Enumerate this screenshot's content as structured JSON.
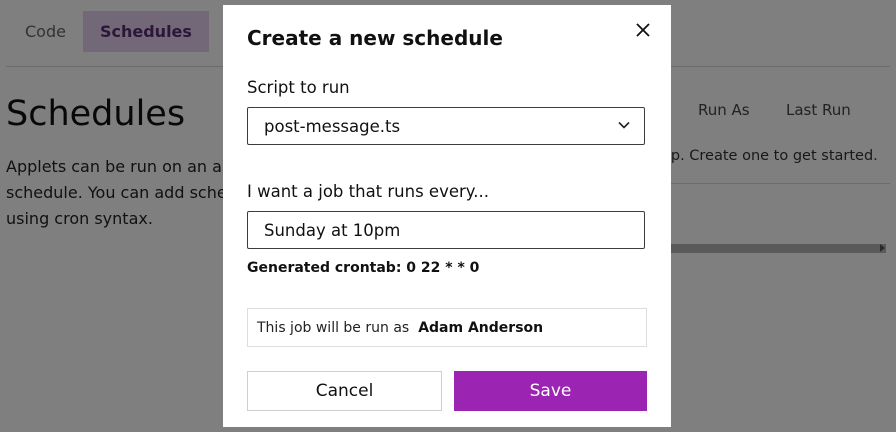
{
  "background": {
    "tabs": [
      {
        "label": "Code",
        "active": false
      },
      {
        "label": "Schedules",
        "active": true
      }
    ],
    "page_title": "Schedules",
    "description": "Applets can be run on an automatic schedule. You can add schedules using cron syntax.",
    "table": {
      "columns": [
        "Run As",
        "Last Run"
      ],
      "empty_message": "op. Create one to get started."
    }
  },
  "modal": {
    "title": "Create a new schedule",
    "close_icon": "close-icon",
    "script_label": "Script to run",
    "script_value": "post-message.ts",
    "schedule_label": "I want a job that runs every...",
    "schedule_value": "Sunday at 10pm",
    "crontab_text": "Generated crontab: 0 22 * * 0",
    "runas_prefix": "This job will be run as",
    "runas_user": "Adam Anderson",
    "cancel_label": "Cancel",
    "save_label": "Save",
    "accent": "#9b24b3"
  }
}
